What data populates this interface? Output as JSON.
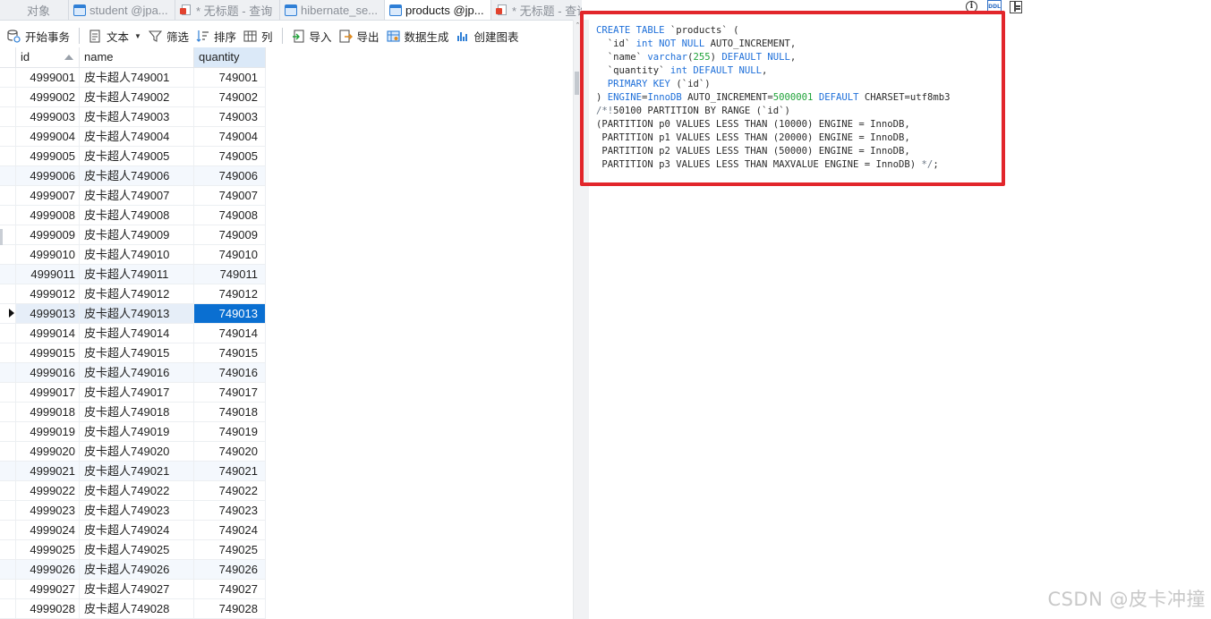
{
  "tabs": {
    "object": "对象",
    "t1": "student @jpa...",
    "t2": "* 无标题 - 查询",
    "t3": "hibernate_se...",
    "t4": "products @jp...",
    "t5": "* 无标题 - 查询"
  },
  "toolbar": {
    "begin_tx": "开始事务",
    "text": "文本",
    "filter": "筛选",
    "sort": "排序",
    "columns": "列",
    "import": "导入",
    "export": "导出",
    "datagen": "数据生成",
    "chart": "创建图表"
  },
  "grid": {
    "columns": [
      "id",
      "name",
      "quantity"
    ],
    "rows": [
      [
        "4999001",
        "皮卡超人749001",
        "749001"
      ],
      [
        "4999002",
        "皮卡超人749002",
        "749002"
      ],
      [
        "4999003",
        "皮卡超人749003",
        "749003"
      ],
      [
        "4999004",
        "皮卡超人749004",
        "749004"
      ],
      [
        "4999005",
        "皮卡超人749005",
        "749005"
      ],
      [
        "4999006",
        "皮卡超人749006",
        "749006"
      ],
      [
        "4999007",
        "皮卡超人749007",
        "749007"
      ],
      [
        "4999008",
        "皮卡超人749008",
        "749008"
      ],
      [
        "4999009",
        "皮卡超人749009",
        "749009"
      ],
      [
        "4999010",
        "皮卡超人749010",
        "749010"
      ],
      [
        "4999011",
        "皮卡超人749011",
        "749011"
      ],
      [
        "4999012",
        "皮卡超人749012",
        "749012"
      ],
      [
        "4999013",
        "皮卡超人749013",
        "749013"
      ],
      [
        "4999014",
        "皮卡超人749014",
        "749014"
      ],
      [
        "4999015",
        "皮卡超人749015",
        "749015"
      ],
      [
        "4999016",
        "皮卡超人749016",
        "749016"
      ],
      [
        "4999017",
        "皮卡超人749017",
        "749017"
      ],
      [
        "4999018",
        "皮卡超人749018",
        "749018"
      ],
      [
        "4999019",
        "皮卡超人749019",
        "749019"
      ],
      [
        "4999020",
        "皮卡超人749020",
        "749020"
      ],
      [
        "4999021",
        "皮卡超人749021",
        "749021"
      ],
      [
        "4999022",
        "皮卡超人749022",
        "749022"
      ],
      [
        "4999023",
        "皮卡超人749023",
        "749023"
      ],
      [
        "4999024",
        "皮卡超人749024",
        "749024"
      ],
      [
        "4999025",
        "皮卡超人749025",
        "749025"
      ],
      [
        "4999026",
        "皮卡超人749026",
        "749026"
      ],
      [
        "4999027",
        "皮卡超人749027",
        "749027"
      ],
      [
        "4999028",
        "皮卡超人749028",
        "749028"
      ]
    ],
    "selected_row_index": 12
  },
  "ddl": {
    "lines": [
      "CREATE TABLE `products` (",
      "  `id` int NOT NULL AUTO_INCREMENT,",
      "  `name` varchar(255) DEFAULT NULL,",
      "  `quantity` int DEFAULT NULL,",
      "  PRIMARY KEY (`id`)",
      ") ENGINE=InnoDB AUTO_INCREMENT=5000001 DEFAULT CHARSET=utf8mb3",
      "/*!50100 PARTITION BY RANGE (`id`)",
      "(PARTITION p0 VALUES LESS THAN (10000) ENGINE = InnoDB,",
      " PARTITION p1 VALUES LESS THAN (20000) ENGINE = InnoDB,",
      " PARTITION p2 VALUES LESS THAN (50000) ENGINE = InnoDB,",
      " PARTITION p3 VALUES LESS THAN MAXVALUE ENGINE = InnoDB) */;"
    ],
    "highlight_color": "#e2262b"
  },
  "icons": {
    "info": "i",
    "ddl": "DDL"
  },
  "watermark": "CSDN @皮卡冲撞",
  "colors": {
    "selection": "#0a6fd1",
    "keyword": "#1e6fd9",
    "number": "#21a33a",
    "box": "#e2262b"
  }
}
